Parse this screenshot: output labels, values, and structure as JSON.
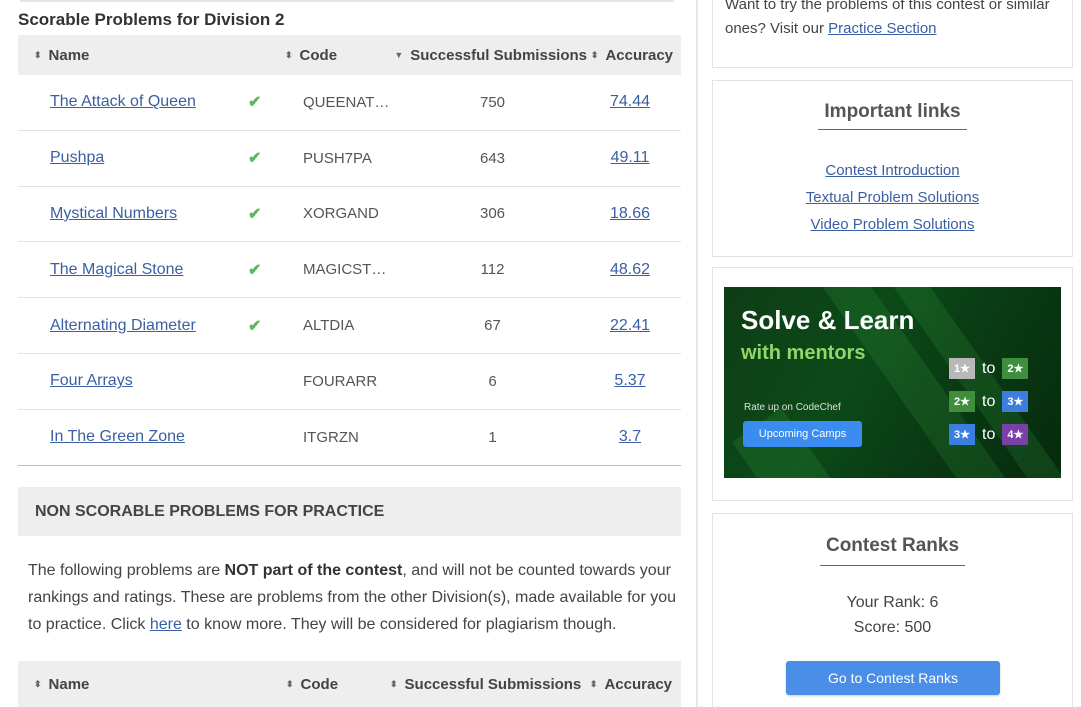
{
  "scorable": {
    "title": "Scorable Problems for Division 2",
    "headers": {
      "name": "Name",
      "code": "Code",
      "subs": "Successful Submissions",
      "acc": "Accuracy"
    },
    "sort_icon_default": "⬍",
    "sort_icon_active": "▼",
    "rows": [
      {
        "name": "The Attack of Queen",
        "solved": true,
        "code": "QUEENAT…",
        "subs": "750",
        "acc": "74.44"
      },
      {
        "name": "Pushpa",
        "solved": true,
        "code": "PUSH7PA",
        "subs": "643",
        "acc": "49.11"
      },
      {
        "name": "Mystical Numbers",
        "solved": true,
        "code": "XORGAND",
        "subs": "306",
        "acc": "18.66"
      },
      {
        "name": "The Magical Stone",
        "solved": true,
        "code": "MAGICST…",
        "subs": "112",
        "acc": "48.62"
      },
      {
        "name": "Alternating Diameter",
        "solved": true,
        "code": "ALTDIA",
        "subs": "67",
        "acc": "22.41"
      },
      {
        "name": "Four Arrays",
        "solved": false,
        "code": "FOURARR",
        "subs": "6",
        "acc": "5.37"
      },
      {
        "name": "In The Green Zone",
        "solved": false,
        "code": "ITGRZN",
        "subs": "1",
        "acc": "3.7"
      }
    ],
    "check_glyph": "✔"
  },
  "nonscorable": {
    "title": "NON SCORABLE PROBLEMS FOR PRACTICE",
    "desc_1": "The following problems are ",
    "desc_bold": "NOT part of the contest",
    "desc_2": ", and will not be counted towards your rankings and ratings. These are problems from the other Division(s), made available for you to practice. Click ",
    "desc_link": "here",
    "desc_3": " to know more. They will be considered for plagiarism though.",
    "headers": {
      "name": "Name",
      "code": "Code",
      "subs": "Successful Submissions",
      "acc": "Accuracy"
    }
  },
  "sidebar": {
    "practice_text_1": "Want to try the problems of this contest or similar ones? Visit our ",
    "practice_link": "Practice Section",
    "links_title": "Important links",
    "links": [
      "Contest Introduction",
      "Textual Problem Solutions",
      "Video Problem Solutions"
    ],
    "banner": {
      "title": "Solve & Learn",
      "subtitle": "with mentors",
      "rate_text": "Rate up on CodeChef",
      "button": "Upcoming Camps",
      "to_word": "to",
      "star_rows": [
        {
          "from": "1★",
          "to": "2★",
          "from_color": "#b8b8b8",
          "to_color": "#3e8e3e"
        },
        {
          "from": "2★",
          "to": "3★",
          "from_color": "#3e8e3e",
          "to_color": "#3b7ee0"
        },
        {
          "from": "3★",
          "to": "4★",
          "from_color": "#3b7ee0",
          "to_color": "#7a3fa8"
        }
      ]
    },
    "ranks_title": "Contest Ranks",
    "rank_line": "Your Rank: 6",
    "score_line": "Score: 500",
    "ranks_button": "Go to Contest Ranks"
  },
  "colors": {
    "link": "#3a5fa3",
    "check": "#5cb85c",
    "button": "#4a8ee8"
  }
}
